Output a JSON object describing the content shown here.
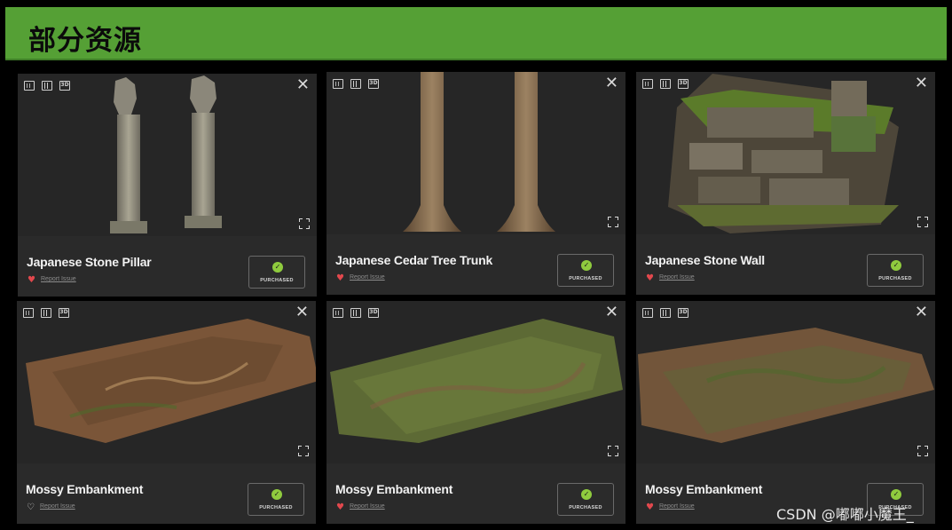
{
  "banner": {
    "title": "部分资源",
    "color": "#55a035"
  },
  "view_icons": [
    "grid-view-icon",
    "columns-view-icon",
    "3d-view-icon"
  ],
  "view_3d_label": "3D",
  "close_glyph": "✕",
  "report_label": "Report Issue",
  "purchased_label": "PURCHASED",
  "cards": [
    {
      "title": "Japanese Stone Pillar",
      "favorited": true
    },
    {
      "title": "Japanese Cedar Tree Trunk",
      "favorited": true
    },
    {
      "title": "Japanese Stone Wall",
      "favorited": true
    },
    {
      "title": "Mossy Embankment",
      "favorited": false
    },
    {
      "title": "Mossy Embankment",
      "favorited": true
    },
    {
      "title": "Mossy Embankment",
      "favorited": true
    }
  ],
  "watermark": "CSDN @嘟嘟小魔王_"
}
